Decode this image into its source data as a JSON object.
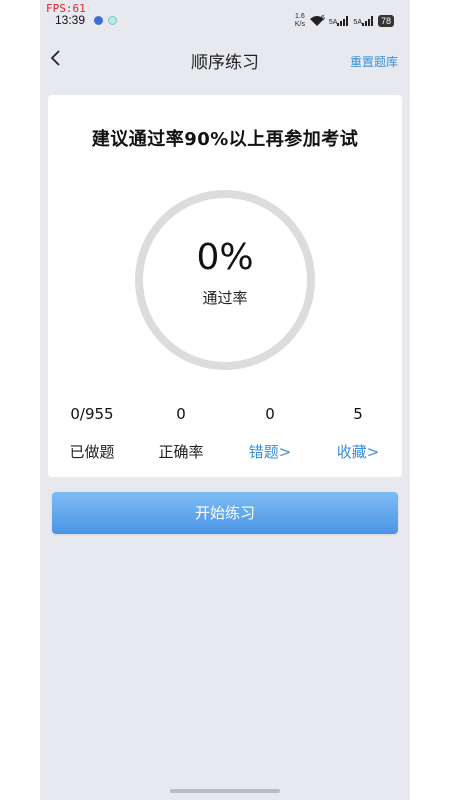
{
  "debug": {
    "fps": "FPS:61"
  },
  "status_bar": {
    "time": "13:39",
    "net_speed": "1.6\nK/s",
    "wifi": "6",
    "sim1": "5A",
    "sim2": "5A",
    "battery": "78"
  },
  "nav": {
    "title": "顺序练习",
    "action": "重置题库"
  },
  "card": {
    "title": "建议通过率90%以上再参加考试",
    "progress": {
      "percent_text": "0%",
      "value": 0,
      "label": "通过率"
    },
    "stats": [
      {
        "value": "0/955",
        "label": "已做题"
      },
      {
        "value": "0",
        "label": "正确率"
      },
      {
        "value": "0",
        "label": "错题>"
      },
      {
        "value": "5",
        "label": "收藏>"
      }
    ]
  },
  "start_button": "开始练习",
  "colors": {
    "accent": "#3a8fd8",
    "ring_track": "#dcdcdc",
    "button_top": "#7fbcf5",
    "button_bottom": "#4a95e4"
  }
}
